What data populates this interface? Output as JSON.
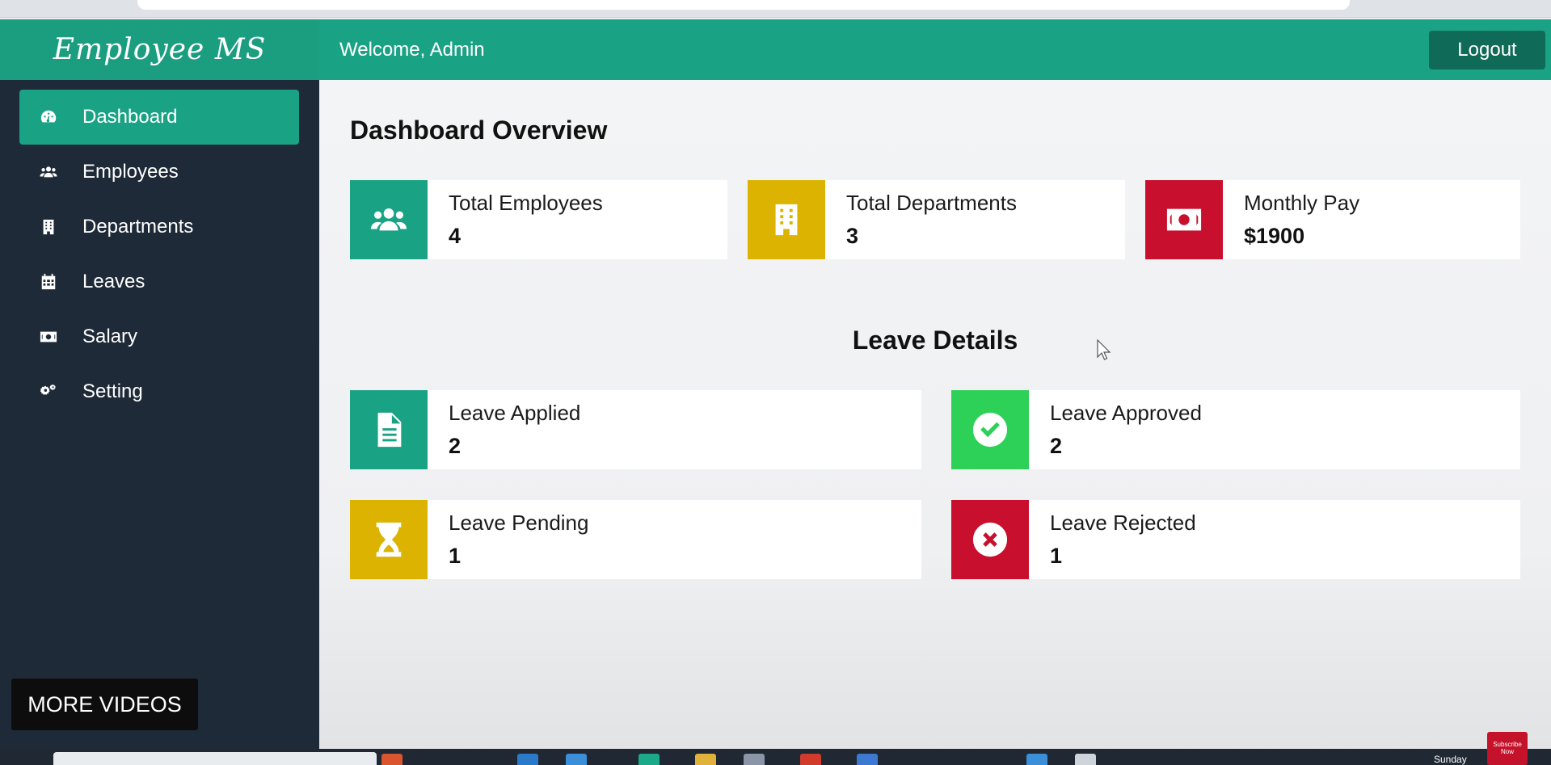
{
  "navbar": {
    "brand": "Employee MS",
    "welcome": "Welcome, Admin",
    "logout_label": "Logout"
  },
  "sidebar": {
    "items": [
      {
        "label": "Dashboard",
        "icon": "dashboard-gauge-icon",
        "active": true
      },
      {
        "label": "Employees",
        "icon": "users-icon",
        "active": false
      },
      {
        "label": "Departments",
        "icon": "building-icon",
        "active": false
      },
      {
        "label": "Leaves",
        "icon": "calendar-icon",
        "active": false
      },
      {
        "label": "Salary",
        "icon": "money-bill-icon",
        "active": false
      },
      {
        "label": "Setting",
        "icon": "gears-icon",
        "active": false
      }
    ]
  },
  "overlay": {
    "more_videos": "MORE VIDEOS",
    "subscribe": "Subscribe Now",
    "taskbar_day": "Sunday"
  },
  "main": {
    "title": "Dashboard Overview",
    "summary_cards": [
      {
        "label": "Total Employees",
        "value": "4",
        "icon": "users-icon",
        "color": "#1aa284"
      },
      {
        "label": "Total Departments",
        "value": "3",
        "icon": "building-icon",
        "color": "#dbb300"
      },
      {
        "label": "Monthly Pay",
        "value": "$1900",
        "icon": "money-bill-icon",
        "color": "#c8102e"
      }
    ],
    "leave_title": "Leave Details",
    "leave_cards": [
      {
        "label": "Leave Applied",
        "value": "2",
        "icon": "file-text-icon",
        "color": "#1aa284"
      },
      {
        "label": "Leave Approved",
        "value": "2",
        "icon": "check-circle-icon",
        "color": "#2ed158"
      },
      {
        "label": "Leave Pending",
        "value": "1",
        "icon": "hourglass-icon",
        "color": "#dbb300"
      },
      {
        "label": "Leave Rejected",
        "value": "1",
        "icon": "times-circle-icon",
        "color": "#c8102e"
      }
    ]
  }
}
